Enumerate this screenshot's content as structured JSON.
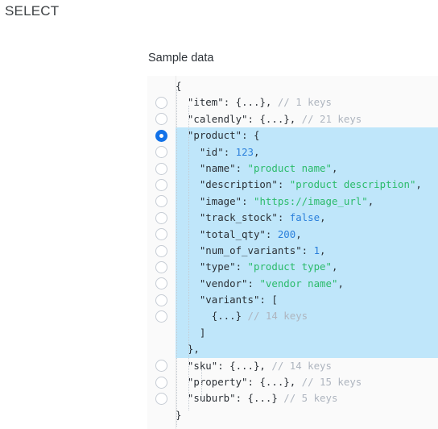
{
  "page": {
    "heading": "SELECT",
    "background": "#ffffff"
  },
  "sample_data": {
    "label": "Sample data",
    "panel_background": "#fafafa",
    "highlight_color": "#bfe6fa",
    "selected_key": "product",
    "colors": {
      "key": "#2b3036",
      "string": "#2bbb6b",
      "number": "#2a7fdb",
      "boolean": "#2a7fdb",
      "comment": "#aeb5bf",
      "radio_checked": "#1372e8",
      "radio_border": "#c6ccd4"
    },
    "rows": [
      {
        "id": "row-open-brace",
        "radio": false,
        "selected": false,
        "highlighted": false,
        "tokens": [
          {
            "t": "pun",
            "v": "{"
          }
        ]
      },
      {
        "id": "row-item",
        "radio": true,
        "selected": false,
        "highlighted": false,
        "tokens": [
          {
            "t": "k",
            "v": "  \"item\""
          },
          {
            "t": "pun",
            "v": ": {...}, "
          },
          {
            "t": "cmt",
            "v": "// 1 keys"
          }
        ]
      },
      {
        "id": "row-calendly",
        "radio": true,
        "selected": false,
        "highlighted": false,
        "tokens": [
          {
            "t": "k",
            "v": "  \"calendly\""
          },
          {
            "t": "pun",
            "v": ": {...}, "
          },
          {
            "t": "cmt",
            "v": "// 21 keys"
          }
        ]
      },
      {
        "id": "row-product",
        "radio": true,
        "selected": true,
        "highlighted": true,
        "tokens": [
          {
            "t": "k",
            "v": "  \"product\""
          },
          {
            "t": "pun",
            "v": ": {"
          }
        ]
      },
      {
        "id": "row-product-id",
        "radio": true,
        "selected": false,
        "highlighted": true,
        "tokens": [
          {
            "t": "k",
            "v": "    \"id\""
          },
          {
            "t": "pun",
            "v": ": "
          },
          {
            "t": "num",
            "v": "123"
          },
          {
            "t": "pun",
            "v": ","
          }
        ]
      },
      {
        "id": "row-product-name",
        "radio": true,
        "selected": false,
        "highlighted": true,
        "tokens": [
          {
            "t": "k",
            "v": "    \"name\""
          },
          {
            "t": "pun",
            "v": ": "
          },
          {
            "t": "str",
            "v": "\"product name\""
          },
          {
            "t": "pun",
            "v": ","
          }
        ]
      },
      {
        "id": "row-product-description",
        "radio": true,
        "selected": false,
        "highlighted": true,
        "tokens": [
          {
            "t": "k",
            "v": "    \"description\""
          },
          {
            "t": "pun",
            "v": ": "
          },
          {
            "t": "str",
            "v": "\"product description\""
          },
          {
            "t": "pun",
            "v": ","
          }
        ]
      },
      {
        "id": "row-product-image",
        "radio": true,
        "selected": false,
        "highlighted": true,
        "tokens": [
          {
            "t": "k",
            "v": "    \"image\""
          },
          {
            "t": "pun",
            "v": ": "
          },
          {
            "t": "str",
            "v": "\"https://image_url\""
          },
          {
            "t": "pun",
            "v": ","
          }
        ]
      },
      {
        "id": "row-product-track-stock",
        "radio": true,
        "selected": false,
        "highlighted": true,
        "tokens": [
          {
            "t": "k",
            "v": "    \"track_stock\""
          },
          {
            "t": "pun",
            "v": ": "
          },
          {
            "t": "bool",
            "v": "false"
          },
          {
            "t": "pun",
            "v": ","
          }
        ]
      },
      {
        "id": "row-product-total-qty",
        "radio": true,
        "selected": false,
        "highlighted": true,
        "tokens": [
          {
            "t": "k",
            "v": "    \"total_qty\""
          },
          {
            "t": "pun",
            "v": ": "
          },
          {
            "t": "num",
            "v": "200"
          },
          {
            "t": "pun",
            "v": ","
          }
        ]
      },
      {
        "id": "row-product-num-of-variants",
        "radio": true,
        "selected": false,
        "highlighted": true,
        "tokens": [
          {
            "t": "k",
            "v": "    \"num_of_variants\""
          },
          {
            "t": "pun",
            "v": ": "
          },
          {
            "t": "num",
            "v": "1"
          },
          {
            "t": "pun",
            "v": ","
          }
        ]
      },
      {
        "id": "row-product-type",
        "radio": true,
        "selected": false,
        "highlighted": true,
        "tokens": [
          {
            "t": "k",
            "v": "    \"type\""
          },
          {
            "t": "pun",
            "v": ": "
          },
          {
            "t": "str",
            "v": "\"product type\""
          },
          {
            "t": "pun",
            "v": ","
          }
        ]
      },
      {
        "id": "row-product-vendor",
        "radio": true,
        "selected": false,
        "highlighted": true,
        "tokens": [
          {
            "t": "k",
            "v": "    \"vendor\""
          },
          {
            "t": "pun",
            "v": ": "
          },
          {
            "t": "str",
            "v": "\"vendor name\""
          },
          {
            "t": "pun",
            "v": ","
          }
        ]
      },
      {
        "id": "row-product-variants",
        "radio": true,
        "selected": false,
        "highlighted": true,
        "tokens": [
          {
            "t": "k",
            "v": "    \"variants\""
          },
          {
            "t": "pun",
            "v": ": ["
          }
        ]
      },
      {
        "id": "row-variants-entry",
        "radio": true,
        "selected": false,
        "highlighted": true,
        "tokens": [
          {
            "t": "pun",
            "v": "      {...} "
          },
          {
            "t": "cmt",
            "v": "// 14 keys"
          }
        ]
      },
      {
        "id": "row-variants-close",
        "radio": false,
        "selected": false,
        "highlighted": true,
        "tokens": [
          {
            "t": "pun",
            "v": "    ]"
          }
        ]
      },
      {
        "id": "row-product-close",
        "radio": false,
        "selected": false,
        "highlighted": true,
        "tokens": [
          {
            "t": "pun",
            "v": "  },"
          }
        ]
      },
      {
        "id": "row-sku",
        "radio": true,
        "selected": false,
        "highlighted": false,
        "tokens": [
          {
            "t": "k",
            "v": "  \"sku\""
          },
          {
            "t": "pun",
            "v": ": {...}, "
          },
          {
            "t": "cmt",
            "v": "// 14 keys"
          }
        ]
      },
      {
        "id": "row-property",
        "radio": true,
        "selected": false,
        "highlighted": false,
        "tokens": [
          {
            "t": "k",
            "v": "  \"property\""
          },
          {
            "t": "pun",
            "v": ": {...}, "
          },
          {
            "t": "cmt",
            "v": "// 15 keys"
          }
        ]
      },
      {
        "id": "row-suburb",
        "radio": true,
        "selected": false,
        "highlighted": false,
        "tokens": [
          {
            "t": "k",
            "v": "  \"suburb\""
          },
          {
            "t": "pun",
            "v": ": {...} "
          },
          {
            "t": "cmt",
            "v": "// 5 keys"
          }
        ]
      },
      {
        "id": "row-close-brace",
        "radio": false,
        "selected": false,
        "highlighted": false,
        "tokens": [
          {
            "t": "pun",
            "v": "}"
          }
        ]
      }
    ]
  }
}
